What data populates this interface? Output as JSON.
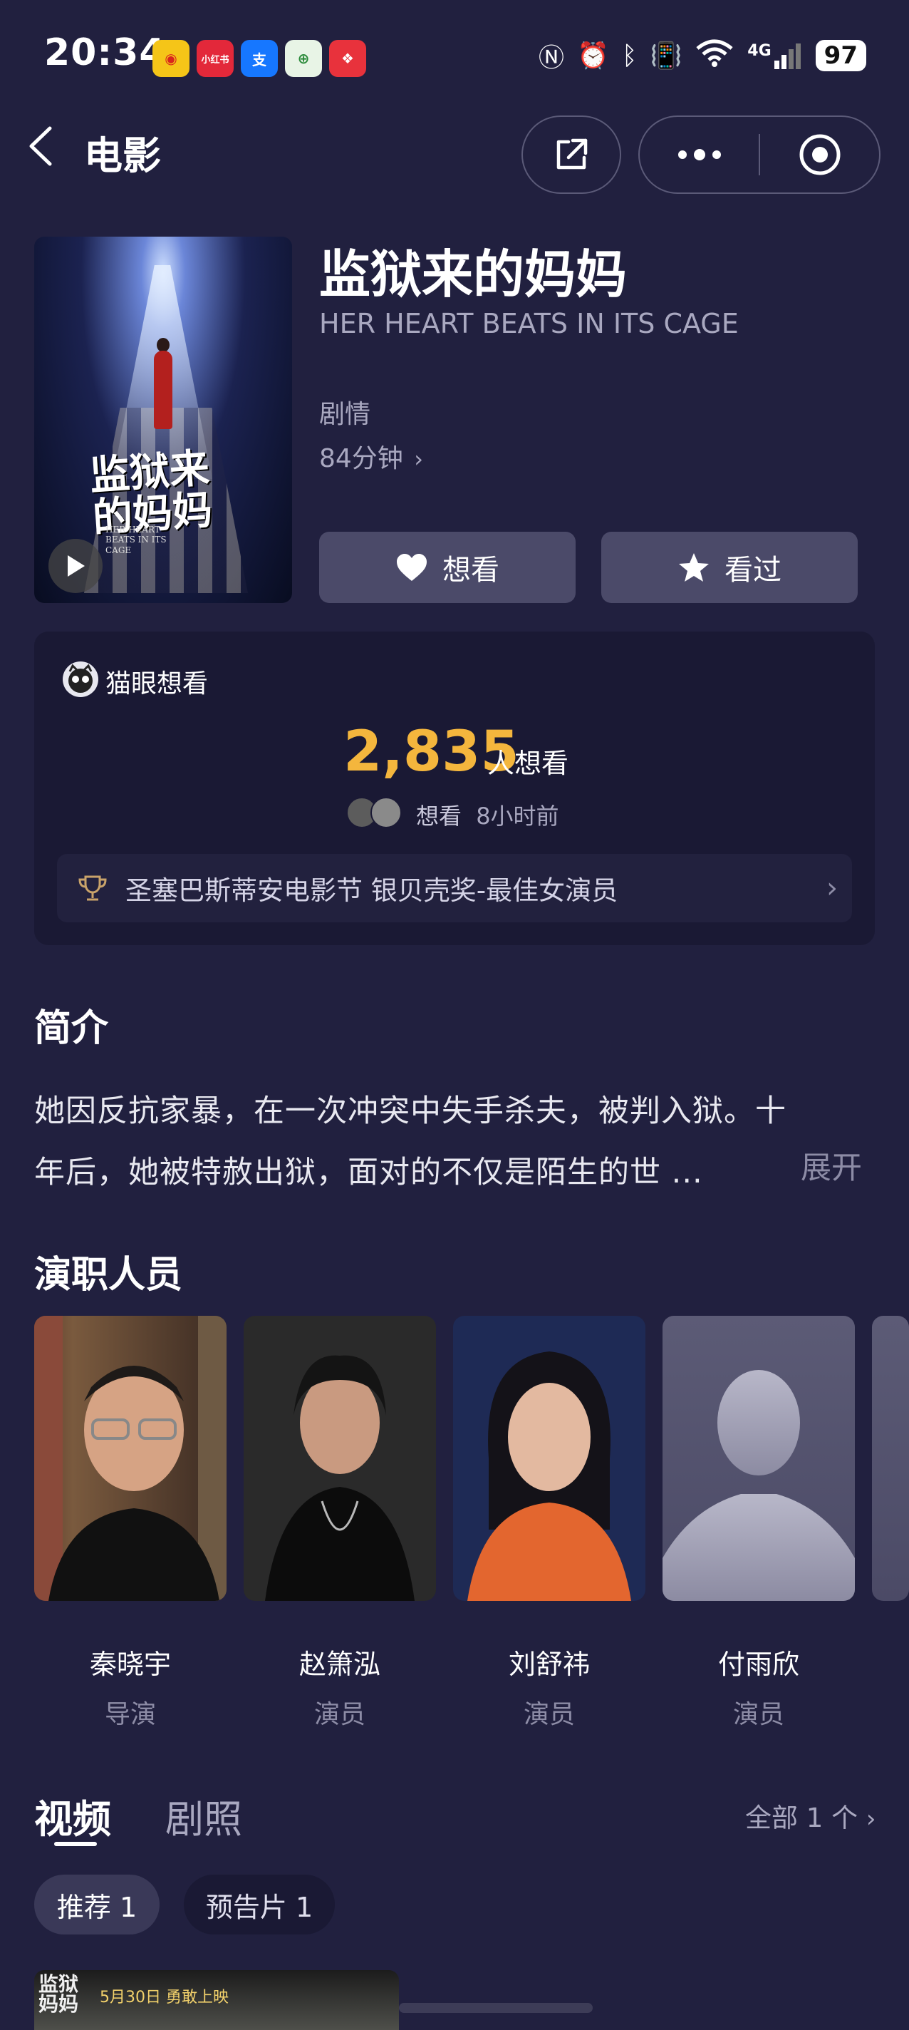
{
  "status_bar": {
    "time": "20:34",
    "app_icons": [
      {
        "name": "weibo-icon",
        "glyph": "◉",
        "bg": "#f5c518",
        "fg": "#d9261c"
      },
      {
        "name": "xiaohongshu-icon",
        "glyph": "小红书",
        "bg": "#e3283a",
        "fg": "#ffffff"
      },
      {
        "name": "alipay-icon",
        "glyph": "支",
        "bg": "#1677ff",
        "fg": "#ffffff"
      },
      {
        "name": "app-green-icon",
        "glyph": "⊕",
        "bg": "#e8f4e6",
        "fg": "#2a8a3a"
      },
      {
        "name": "app-red-icon",
        "glyph": "❖",
        "bg": "#e8323c",
        "fg": "#ffffff"
      }
    ],
    "network": "4G",
    "battery": "97"
  },
  "nav": {
    "title": "电影"
  },
  "movie": {
    "title": "监狱来的妈妈",
    "english_title": "HER HEART BEATS IN ITS CAGE",
    "genre": "剧情",
    "duration": "84分钟",
    "poster_title": "监狱来的妈妈",
    "poster_subtitle": "HER HEART BEATS IN ITS CAGE",
    "want_label": "想看",
    "seen_label": "看过"
  },
  "maoyan": {
    "label": "猫眼想看",
    "count": "2,835",
    "count_suffix": "人想看",
    "recent_text": "想看",
    "recent_time": "8小时前",
    "award": "圣塞巴斯蒂安电影节 银贝壳奖-最佳女演员"
  },
  "synopsis": {
    "heading": "简介",
    "text": "她因反抗家暴，在一次冲突中失手杀夫，被判入狱。十年后，她被特赦出狱，面对的不仅是陌生的世 ...",
    "expand": "展开"
  },
  "cast": {
    "heading": "演职人员",
    "members": [
      {
        "name": "秦晓宇",
        "role": "导演"
      },
      {
        "name": "赵箫泓",
        "role": "演员"
      },
      {
        "name": "刘舒祎",
        "role": "演员"
      },
      {
        "name": "付雨欣",
        "role": "演员"
      }
    ]
  },
  "media": {
    "tabs": [
      "视频",
      "剧照"
    ],
    "active_tab": "视频",
    "all_link": "全部 1 个",
    "chips": [
      "推荐 1",
      "预告片 1"
    ],
    "thumb_text": "5月30日 勇敢上映"
  }
}
